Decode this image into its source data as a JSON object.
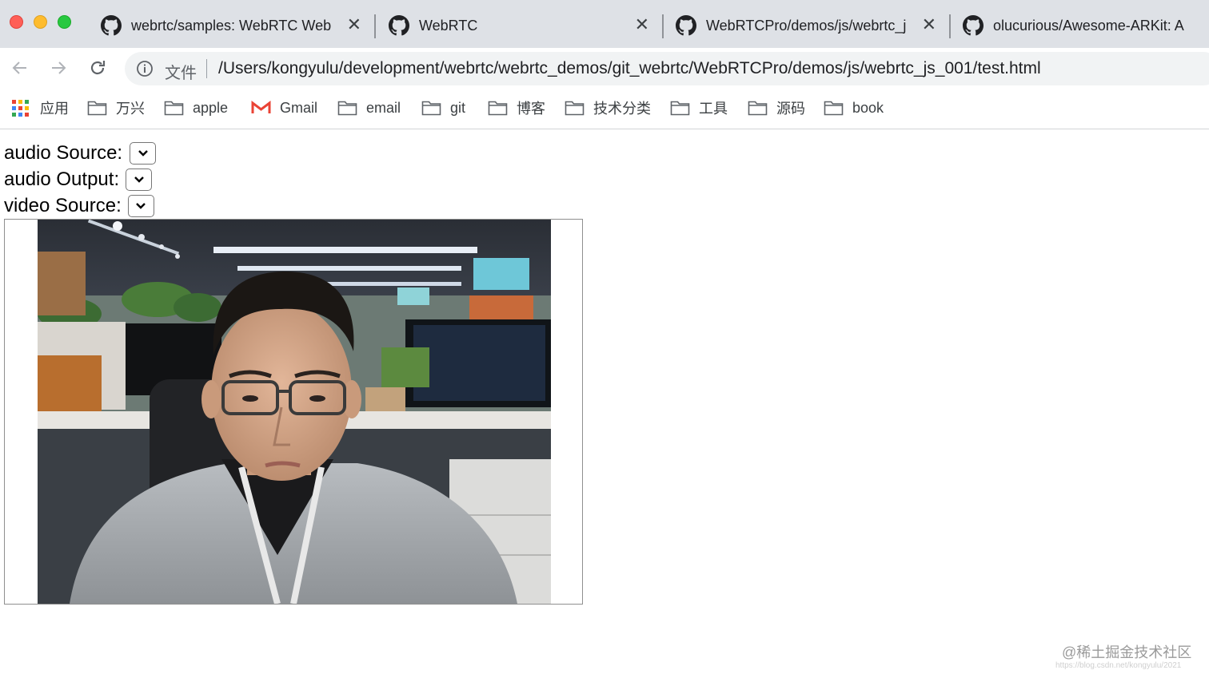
{
  "browser": {
    "tabs": [
      {
        "title": "webrtc/samples: WebRTC Web",
        "close": "✕"
      },
      {
        "title": "WebRTC",
        "close": "✕"
      },
      {
        "title": "WebRTCPro/demos/js/webrtc_j",
        "close": "✕"
      },
      {
        "title": "olucurious/Awesome-ARKit: A",
        "close": ""
      }
    ],
    "omnibox": {
      "scheme_label": "文件",
      "url": "/Users/kongyulu/development/webrtc/webrtc_demos/git_webrtc/WebRTCPro/demos/js/webrtc_js_001/test.html"
    },
    "bookmarks": [
      {
        "label": "应用",
        "icon": "apps-grid-icon"
      },
      {
        "label": "万兴",
        "icon": "folder-icon"
      },
      {
        "label": "apple",
        "icon": "folder-icon"
      },
      {
        "label": "Gmail",
        "icon": "gmail-icon"
      },
      {
        "label": "email",
        "icon": "folder-icon"
      },
      {
        "label": "git",
        "icon": "folder-icon"
      },
      {
        "label": "博客",
        "icon": "folder-icon"
      },
      {
        "label": "技术分类",
        "icon": "folder-icon"
      },
      {
        "label": "工具",
        "icon": "folder-icon"
      },
      {
        "label": "源码",
        "icon": "folder-icon"
      },
      {
        "label": "book",
        "icon": "folder-icon"
      }
    ]
  },
  "page": {
    "audio_source_label": "audio Source:",
    "audio_output_label": "audio Output:",
    "video_source_label": "video Source:",
    "audio_source_value": "",
    "audio_output_value": "",
    "video_source_value": ""
  },
  "watermark": {
    "text": "@稀土掘金技术社区",
    "sub": "https://blog.csdn.net/kongyulu/2021"
  },
  "colors": {
    "tabstrip_bg": "#dee1e6",
    "omnibox_bg": "#f1f3f4",
    "traffic_red": "#ff5f57",
    "traffic_yellow": "#febc2e",
    "traffic_green": "#28c840"
  }
}
